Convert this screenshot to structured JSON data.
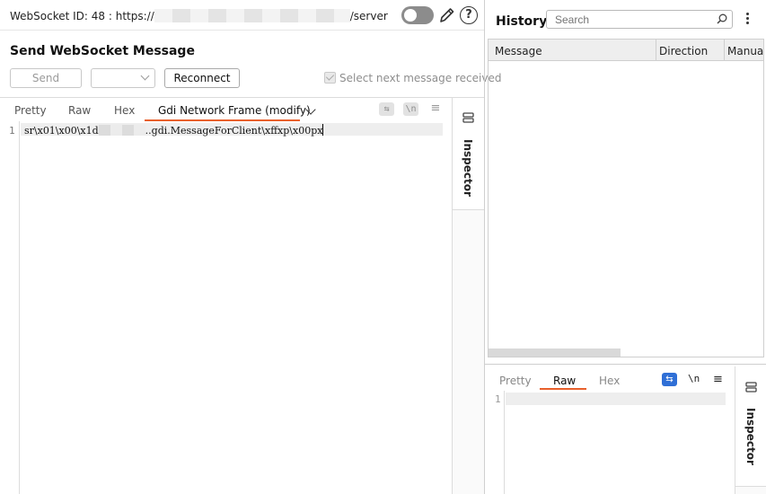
{
  "header": {
    "ws_id_prefix": "WebSocket ID: 48 : https://",
    "ws_id_suffix": "/server",
    "help_glyph": "?"
  },
  "send_panel": {
    "title": "Send WebSocket Message",
    "send_label": "Send",
    "dropdown_value": "",
    "reconnect_label": "Reconnect",
    "checkbox_label": "Select next message received",
    "checkbox_checked": true
  },
  "editor": {
    "tabs": [
      "Pretty",
      "Raw",
      "Hex",
      "Gdi Network Frame (modify)"
    ],
    "active_tab": "Gdi Network Frame (modify)",
    "tool_wrap": "⇆",
    "tool_newline": "\\n",
    "tool_menu": "≡",
    "line_number": "1",
    "code_prefix": "sr\\x01\\x00\\x1d",
    "code_suffix": "..gdi.MessageForClient\\xffxp\\x00px",
    "inspector_label": "Inspector"
  },
  "history": {
    "title": "History",
    "search_placeholder": "Search",
    "columns": [
      "Message",
      "Direction",
      "Manua"
    ]
  },
  "response": {
    "tabs": [
      "Pretty",
      "Raw",
      "Hex"
    ],
    "active_tab": "Raw",
    "tool_wrap": "⇆",
    "tool_newline": "\\n",
    "tool_menu": "≡",
    "line_number": "1",
    "inspector_label": "Inspector"
  },
  "colors": {
    "accent_orange": "#e8602c",
    "accent_blue": "#2f6fd6"
  },
  "icons": {
    "toggle": "toggle-switch-icon",
    "edit": "pencil-icon",
    "help": "help-icon",
    "search": "search-icon",
    "more": "kebab-menu-icon",
    "inspector": "inspector-icon"
  }
}
